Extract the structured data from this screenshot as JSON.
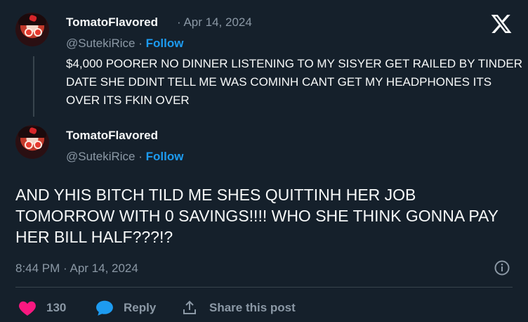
{
  "tweet1": {
    "display_name": "TomatoFlavored",
    "separator": "·",
    "date": "Apr 14, 2024",
    "handle": "@SutekiRice",
    "follow_label": "Follow",
    "text": "$4,000 POORER NO DINNER LISTENING TO MY SISYER GET RAILED BY TINDER DATE SHE DDINT TELL ME WAS COMINH CANT GET MY HEADPHONES ITS OVER ITS FKIN OVER"
  },
  "tweet2": {
    "display_name": "TomatoFlavored",
    "handle": "@SutekiRice",
    "separator": "·",
    "follow_label": "Follow",
    "text": "AND YHIS BITCH TILD ME SHES QUITTINH HER JOB TOMORROW WITH 0 SAVINGS!!!! WHO SHE THINK GONNA PAY HER BILL HALF???!?",
    "timestamp": "8:44 PM · Apr 14, 2024"
  },
  "actions": {
    "like_count": "130",
    "reply_label": "Reply",
    "share_label": "Share this post"
  },
  "icons": {
    "x_logo": "x-logo-icon",
    "info": "info-icon",
    "heart": "heart-icon",
    "reply": "speech-bubble-icon",
    "share": "share-upload-icon"
  },
  "colors": {
    "background": "#15202b",
    "accent": "#1d9bf0",
    "like": "#f91880",
    "muted": "#8b98a5"
  }
}
